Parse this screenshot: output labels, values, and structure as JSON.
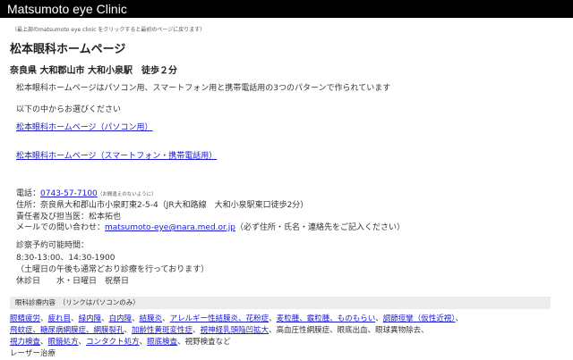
{
  "header": {
    "title": "Matsumoto eye Clinic"
  },
  "note": "（最上部のmatsumoto eye clinic をクリックすると最初のページに戻ります）",
  "title": "松本眼科ホームページ",
  "subtitle": "奈良県 大和郡山市 大和小泉駅　徒歩２分",
  "intro": "松本眼科ホームページはパソコン用、スマートフォン用と携帯電話用の3つのパターンで作られています",
  "choose": "以下の中からお選びください",
  "links": [
    "松本眼科ホームページ（パソコン用）",
    "松本眼科ホームページ（スマートフォン・携帯電話用）"
  ],
  "contact": {
    "phone_label": "電話：",
    "phone": "0743-57-7100",
    "phone_note": "（お間違えのないように）",
    "address": "住所：奈良県大和郡山市小泉町東2-5-4（JR大和路線　大和小泉駅東口徒歩2分）",
    "doctor": "責任者及び担当医：松本拓也",
    "mail_label": "メールでの問い合わせ：",
    "mail": "matsumoto-eye@nara.med.or.jp",
    "mail_note": "（必ず住所・氏名・連絡先をご記入ください）"
  },
  "hours": {
    "label": "診察予約可能時間：",
    "times": "8:30-13:00、14:30-1900",
    "saturday": "（土曜日の午後も通常どおり診療を行っております）",
    "closed": "休診日　　水・日曜日　祝祭日"
  },
  "services": {
    "heading": "眼科診療内容　（リンクはパソコンのみ）",
    "lines": [
      [
        {
          "t": "眼精疲労",
          "l": true
        },
        {
          "t": "、",
          "l": false
        },
        {
          "t": "疲れ目",
          "l": true
        },
        {
          "t": "、",
          "l": false
        },
        {
          "t": "緑内障",
          "l": true
        },
        {
          "t": "、",
          "l": false
        },
        {
          "t": "白内障",
          "l": true
        },
        {
          "t": "、",
          "l": false
        },
        {
          "t": "結膜炎",
          "l": true
        },
        {
          "t": "、",
          "l": false
        },
        {
          "t": "アレルギー性結膜炎、花粉症",
          "l": true
        },
        {
          "t": "、",
          "l": false
        },
        {
          "t": "麦粒腫、霰粒腫、ものもらい",
          "l": true
        },
        {
          "t": "、",
          "l": false
        },
        {
          "t": "調節痙攣（仮性近視）",
          "l": true
        },
        {
          "t": "、",
          "l": false
        }
      ],
      [
        {
          "t": "飛蚊症、糖尿病網膜症、網膜裂孔",
          "l": true
        },
        {
          "t": "、",
          "l": false
        },
        {
          "t": "加齢性黄斑変性症",
          "l": true
        },
        {
          "t": "、",
          "l": false
        },
        {
          "t": "視神経乳頭陥凹拡大",
          "l": true
        },
        {
          "t": "、高血圧性網膜症、眼底出血、眼球異物除去、",
          "l": false
        }
      ],
      [
        {
          "t": "視力検査",
          "l": true
        },
        {
          "t": "、",
          "l": false
        },
        {
          "t": "眼鏡処方",
          "l": true
        },
        {
          "t": "、",
          "l": false
        },
        {
          "t": "コンタクト処方",
          "l": true
        },
        {
          "t": "、",
          "l": false
        },
        {
          "t": "眼底検査",
          "l": true
        },
        {
          "t": "、視野検査など",
          "l": false
        }
      ],
      [
        {
          "t": "レーザー治療",
          "l": false
        }
      ]
    ]
  }
}
